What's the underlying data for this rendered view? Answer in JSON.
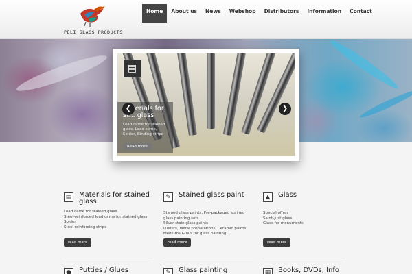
{
  "brand": {
    "name": "PELI GLASS PRODUCTS"
  },
  "nav": {
    "items": [
      {
        "label": "Home",
        "active": true
      },
      {
        "label": "About us",
        "active": false
      },
      {
        "label": "News",
        "active": false
      },
      {
        "label": "Webshop",
        "active": false
      },
      {
        "label": "Distributors",
        "active": false
      },
      {
        "label": "Information",
        "active": false
      },
      {
        "label": "Contact",
        "active": false
      }
    ]
  },
  "slider": {
    "caption_title": "Materials for st... glass",
    "caption_text": "Lead came for stained glass, Lead came, Solder, Binding strips",
    "button_label": "Read more",
    "prev_icon": "chevron-left-icon",
    "next_icon": "chevron-right-icon"
  },
  "columns": [
    {
      "icon": "stained-glass-icon",
      "title": "Materials for stained glass",
      "items": [
        "Lead came for stained glass",
        "Steel-reinforced lead came for stained glass",
        "Solder",
        "Steel reinforcing strips"
      ],
      "button": "read more"
    },
    {
      "icon": "paint-icon",
      "title": "Stained glass paint",
      "items": [
        "Stained glass paints, Pre-packaged stained glass painting sets",
        "Silver stain glass paints",
        "Lusters, Metal preparations, Ceramic paints",
        "Mediums & oils for glass painting"
      ],
      "button": "read more"
    },
    {
      "icon": "glass-icon",
      "title": "Glass",
      "items": [
        "Special offers",
        "Saint-Just glass",
        "Glass for monuments"
      ],
      "button": "read more"
    }
  ],
  "bottom_columns": [
    {
      "icon": "putty-icon",
      "title": "Putties / Glues"
    },
    {
      "icon": "brush-icon",
      "title": "Glass painting"
    },
    {
      "icon": "book-icon",
      "title": "Books, DVDs, Info"
    }
  ],
  "colors": {
    "accent": "#444444",
    "button": "#3c3c3c"
  }
}
